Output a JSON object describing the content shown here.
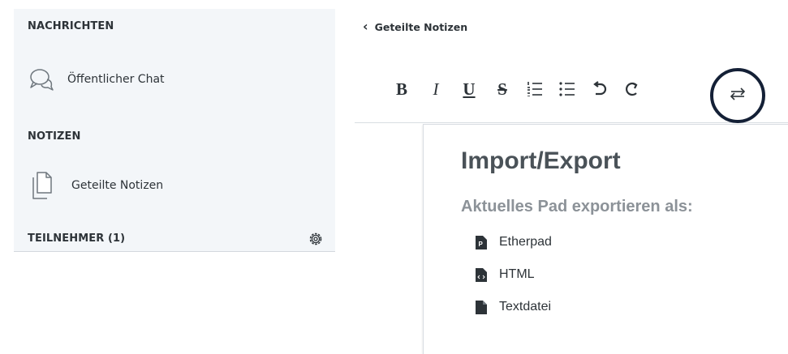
{
  "sidebar": {
    "messages_title": "NACHRICHTEN",
    "public_chat_label": "Öffentlicher Chat",
    "notes_title": "NOTIZEN",
    "shared_notes_label": "Geteilte Notizen",
    "participants_title": "TEILNEHMER (1)"
  },
  "notes": {
    "back_label": "Geteilte Notizen",
    "toolbar": {
      "bold": "B",
      "italic": "I",
      "underline": "U",
      "strike": "S",
      "ordered_list_icon": "ordered-list-icon",
      "unordered_list_icon": "unordered-list-icon",
      "undo_icon": "undo-icon",
      "redo_icon": "redo-icon",
      "import_export_icon": "import-export-icon",
      "highlight_color": "#142036"
    }
  },
  "import_export": {
    "title": "Import/Export",
    "subtitle": "Aktuelles Pad exportieren als:",
    "options": [
      {
        "label": "Etherpad",
        "icon": "etherpad-file-icon"
      },
      {
        "label": "HTML",
        "icon": "html-file-icon"
      },
      {
        "label": "Textdatei",
        "icon": "text-file-icon"
      }
    ]
  }
}
